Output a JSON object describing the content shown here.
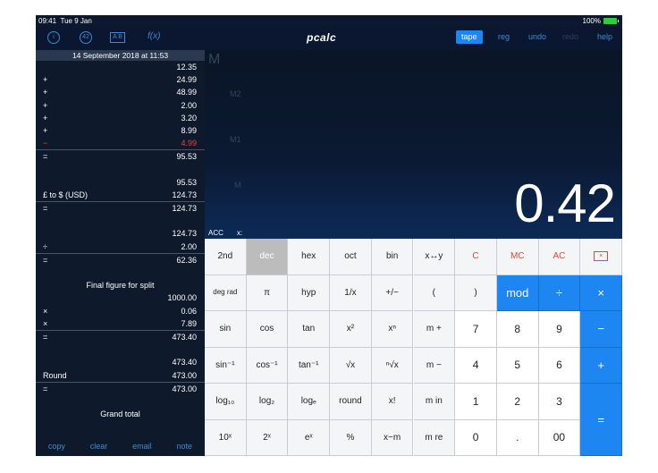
{
  "status_bar": {
    "time": "09:41",
    "date": "Tue 9 Jan",
    "battery": "100%"
  },
  "toolbar": {
    "info_icon": "info-icon",
    "variables_label": "42",
    "ab_label": "A B",
    "fx_label": "f(x)",
    "logo": "pcalc",
    "tape_label": "tape",
    "reg_label": "reg",
    "undo_label": "undo",
    "redo_label": "redo",
    "help_label": "help",
    "accent_color": "#1d86f0"
  },
  "tape": {
    "header": "14 September 2018 at 11:53",
    "rows": [
      {
        "op": "",
        "val": "12.35"
      },
      {
        "op": "+",
        "val": "24.99"
      },
      {
        "op": "+",
        "val": "48.99"
      },
      {
        "op": "+",
        "val": "2.00"
      },
      {
        "op": "+",
        "val": "3.20"
      },
      {
        "op": "+",
        "val": "8.99"
      },
      {
        "op": "−",
        "val": "4.99"
      },
      {
        "op": "=",
        "val": "95.53"
      },
      {
        "op": "",
        "val": ""
      },
      {
        "op": "",
        "val": "95.53"
      },
      {
        "op": "£ to $ (USD)",
        "val": "124.73"
      },
      {
        "op": "=",
        "val": "124.73"
      },
      {
        "op": "",
        "val": ""
      },
      {
        "op": "",
        "val": "124.73"
      },
      {
        "op": "÷",
        "val": "2.00"
      },
      {
        "op": "=",
        "val": "62.36"
      },
      {
        "op": "",
        "val": ""
      },
      {
        "note": "Final figure for split"
      },
      {
        "op": "",
        "val": "1000.00"
      },
      {
        "op": "×",
        "val": "0.06"
      },
      {
        "op": "×",
        "val": "7.89"
      },
      {
        "op": "=",
        "val": "473.40"
      },
      {
        "op": "",
        "val": ""
      },
      {
        "op": "",
        "val": "473.40"
      },
      {
        "op": "Round",
        "val": "473.00"
      },
      {
        "op": "=",
        "val": "473.00"
      },
      {
        "op": "",
        "val": ""
      },
      {
        "note": "Grand total"
      }
    ],
    "footer": {
      "copy": "copy",
      "clear": "clear",
      "email": "email",
      "note": "note"
    }
  },
  "display": {
    "memory_main": "M",
    "memory_m2": "M2",
    "memory_m1": "M1",
    "memory_m": "M",
    "value": "0.42",
    "acc_label": "ACC",
    "x_label": "x:"
  },
  "keypad": {
    "rows": [
      [
        "2nd",
        "dec",
        "hex",
        "oct",
        "bin",
        "x↔y",
        "C",
        "MC",
        "AC",
        "⌫"
      ],
      [
        "deg rad",
        "π",
        "hyp",
        "1/x",
        "+/−",
        "(",
        ")",
        "mod",
        "÷",
        "×"
      ],
      [
        "sin",
        "cos",
        "tan",
        "x²",
        "xⁿ",
        "m +",
        "7",
        "8",
        "9",
        "−"
      ],
      [
        "sin⁻¹",
        "cos⁻¹",
        "tan⁻¹",
        "√x",
        "ⁿ√x",
        "m −",
        "4",
        "5",
        "6",
        "+"
      ],
      [
        "log₁₀",
        "log₂",
        "logₑ",
        "round",
        "x!",
        "m in",
        "1",
        "2",
        "3",
        "="
      ],
      [
        "10ˣ",
        "2ˣ",
        "eˣ",
        "%",
        "x~m",
        "m re",
        "0",
        ".",
        "00",
        ""
      ]
    ]
  }
}
